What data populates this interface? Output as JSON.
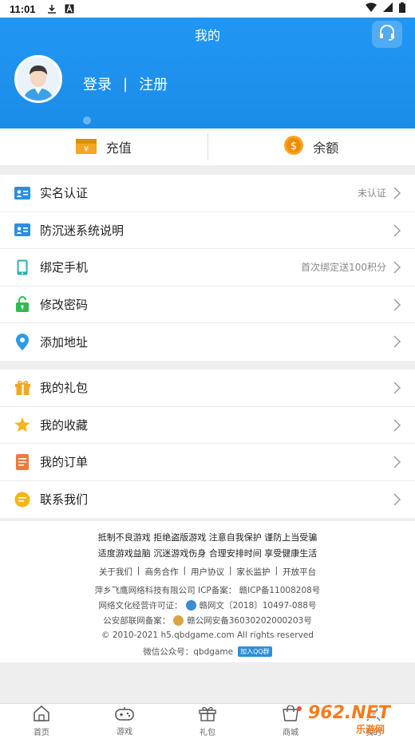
{
  "status_bar": {
    "time": "11:01"
  },
  "header": {
    "title": "我的",
    "login": "登录",
    "separator": "|",
    "register": "注册"
  },
  "topup": {
    "recharge": "充值",
    "balance": "余额"
  },
  "menu1": [
    {
      "label": "实名认证",
      "extra": "未认证"
    },
    {
      "label": "防沉迷系统说明",
      "extra": ""
    },
    {
      "label": "绑定手机",
      "extra": "首次绑定送100积分"
    },
    {
      "label": "修改密码",
      "extra": ""
    },
    {
      "label": "添加地址",
      "extra": ""
    }
  ],
  "menu2": [
    {
      "label": "我的礼包"
    },
    {
      "label": "我的收藏"
    },
    {
      "label": "我的订单"
    },
    {
      "label": "联系我们"
    }
  ],
  "footer": {
    "line1": "抵制不良游戏 拒绝盗版游戏 注意自我保护 谨防上当受骗",
    "line2": "适度游戏益脑 沉迷游戏伤身 合理安排时间 享受健康生活",
    "links": [
      "关于我们",
      "|",
      "商务合作",
      "|",
      "用户协议",
      "|",
      "家长监护",
      "|",
      "开放平台"
    ],
    "company": "萍乡飞鹰网络科技有限公司  ICP备案：  赣ICP备11008208号",
    "license_label": "网络文化经营许可证：",
    "license_value": "赣网文〔2018〕10497-088号",
    "police_label": "公安部联网备案：",
    "police_value": "赣公网安备36030202000203号",
    "copyright": "© 2010-2021 h5.qbdgame.com All rights reserved",
    "wechat": "微信公众号：qbdgame",
    "qq": "加入QQ群"
  },
  "tabbar": [
    {
      "label": "首页"
    },
    {
      "label": "游戏"
    },
    {
      "label": "礼包"
    },
    {
      "label": "商城"
    },
    {
      "label": "我的"
    }
  ],
  "watermark": {
    "line1": "962.NET",
    "line2": "乐游网"
  },
  "colors": {
    "primary": "#2196f3",
    "orange": "#f5a623",
    "watermark": "#f57c1f"
  }
}
